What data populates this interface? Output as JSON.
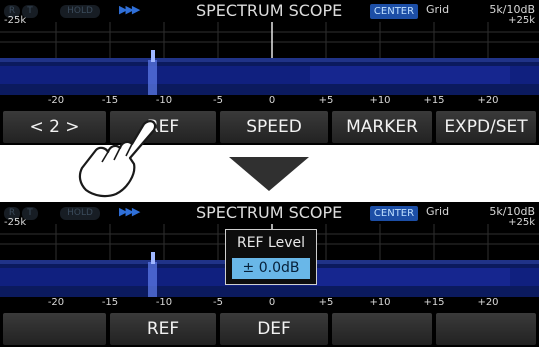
{
  "top_screen": {
    "badges": {
      "r": "R",
      "t": "T",
      "hold": "HOLD"
    },
    "arrows": "▶▶▶",
    "title": "SPECTRUM SCOPE",
    "center_badge": "CENTER",
    "grid_label": "Grid",
    "span_label": "5k/10dB",
    "edge_left": "-25k",
    "edge_right": "+25k",
    "scale": [
      "-20",
      "-15",
      "-10",
      "-5",
      "0",
      "+5",
      "+10",
      "+15",
      "+20"
    ],
    "buttons": [
      "< 2 >",
      "REF",
      "SPEED",
      "MARKER",
      "EXPD/SET"
    ]
  },
  "bottom_screen": {
    "badges": {
      "r": "R",
      "t": "T",
      "hold": "HOLD"
    },
    "arrows": "▶▶▶",
    "title": "SPECTRUM SCOPE",
    "center_badge": "CENTER",
    "grid_label": "Grid",
    "span_label": "5k/10dB",
    "edge_left": "-25k",
    "edge_right": "+25k",
    "scale": [
      "-20",
      "-15",
      "-10",
      "-5",
      "0",
      "+5",
      "+10",
      "+15",
      "+20"
    ],
    "popup": {
      "title": "REF Level",
      "value": "± 0.0dB"
    },
    "buttons": [
      "",
      "REF",
      "DEF",
      "",
      ""
    ]
  },
  "icons": {
    "transition": "down-triangle-icon",
    "tap": "hand-tap-icon"
  },
  "colors": {
    "background": "#000000",
    "center_badge": "#1c4ea6",
    "popup_value": "#69b7e8",
    "arrows": "#2f6fd8",
    "button": "#2c2c2c"
  }
}
